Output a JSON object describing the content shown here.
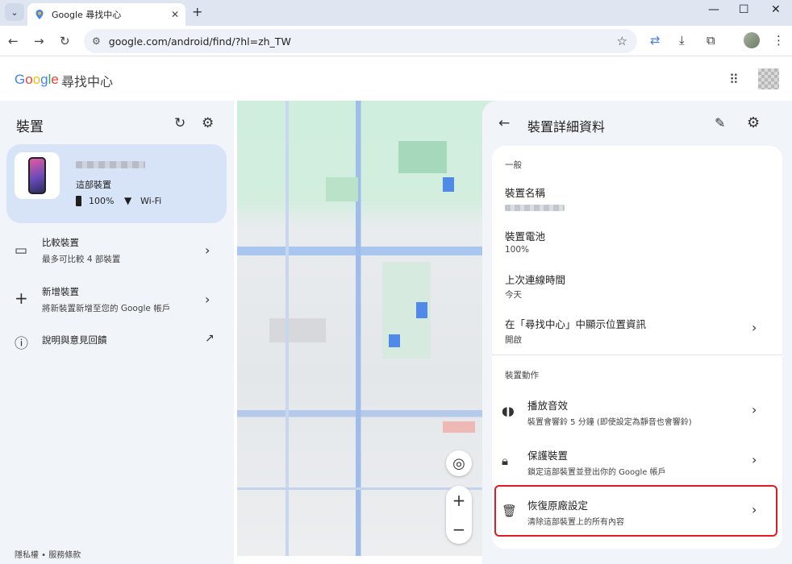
{
  "browser": {
    "tab_title": "Google 尋找中心",
    "url": "google.com/android/find/?hl=zh_TW",
    "new_tab": "+",
    "minimize": "—",
    "maximize": "☐",
    "close": "✕"
  },
  "header": {
    "logo": "Google",
    "app_name": "尋找中心"
  },
  "left_panel": {
    "title": "裝置",
    "device": {
      "subtitle": "這部裝置",
      "battery": "100%",
      "network": "Wi-Fi"
    },
    "items": [
      {
        "title": "比較裝置",
        "subtitle": "最多可比較 4 部裝置"
      },
      {
        "title": "新增裝置",
        "subtitle": "將新裝置新增至您的 Google 帳戶"
      },
      {
        "title": "說明與意見回饋",
        "subtitle": ""
      }
    ],
    "footer": "隱私權 • 服務條款"
  },
  "map": {
    "zoom_in": "+",
    "zoom_out": "−"
  },
  "right_panel": {
    "title": "裝置詳細資料",
    "general_section": "一般",
    "fields": [
      {
        "label": "裝置名稱",
        "value": ""
      },
      {
        "label": "裝置電池",
        "value": "100%"
      },
      {
        "label": "上次連線時間",
        "value": "今天"
      },
      {
        "label": "在「尋找中心」中顯示位置資訊",
        "value": "開啟"
      }
    ],
    "actions_section": "裝置動作",
    "actions": [
      {
        "label": "播放音效",
        "subtitle": "裝置會響鈴 5 分鐘 (即使設定為靜音也會響鈴)"
      },
      {
        "label": "保護裝置",
        "subtitle": "鎖定這部裝置並登出你的 Google 帳戶"
      },
      {
        "label": "恢復原廠設定",
        "subtitle": "清除這部裝置上的所有內容"
      }
    ]
  },
  "colors": {
    "highlight": "#e01b24",
    "device_card": "#d7e3f7",
    "panel_bg": "#f1f4f9"
  }
}
